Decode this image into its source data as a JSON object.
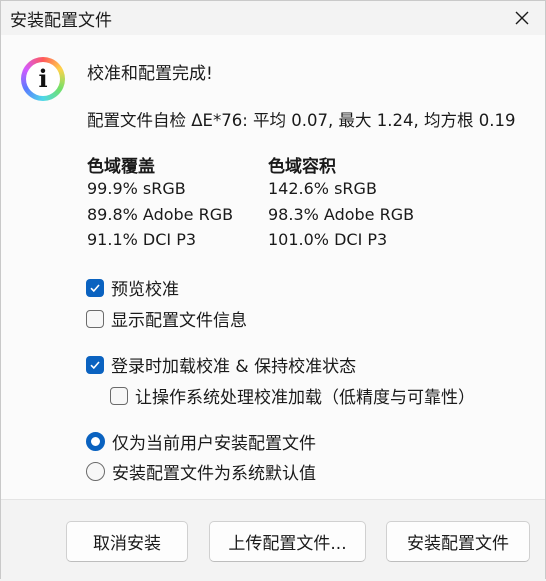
{
  "window": {
    "title": "安装配置文件"
  },
  "message": {
    "headline": "校准和配置完成!",
    "self_check": "配置文件自检 ΔE*76: 平均 0.07, 最大 1.24, 均方根 0.19"
  },
  "gamut_coverage": {
    "title": "色域覆盖",
    "values": [
      "99.9% sRGB",
      "89.8% Adobe RGB",
      "91.1% DCI P3"
    ]
  },
  "gamut_volume": {
    "title": "色域容积",
    "values": [
      "142.6% sRGB",
      "98.3% Adobe RGB",
      "101.0% DCI P3"
    ]
  },
  "options": {
    "preview_calibration": {
      "label": "预览校准",
      "checked": true
    },
    "show_profile_info": {
      "label": "显示配置文件信息",
      "checked": false
    },
    "load_on_login": {
      "label": "登录时加载校准 & 保持校准状态",
      "checked": true
    },
    "os_handles_loading": {
      "label": "让操作系统处理校准加载（低精度与可靠性）",
      "checked": false
    },
    "install_scope": {
      "options": [
        "仅为当前用户安装配置文件",
        "安装配置文件为系统默认值"
      ],
      "selected": 0
    }
  },
  "buttons": {
    "cancel": "取消安装",
    "upload": "上传配置文件...",
    "install": "安装配置文件"
  },
  "colors": {
    "accent": "#0a62c0"
  },
  "icons": {
    "info": "info-icon",
    "close": "close-icon",
    "check": "checkmark-icon"
  }
}
